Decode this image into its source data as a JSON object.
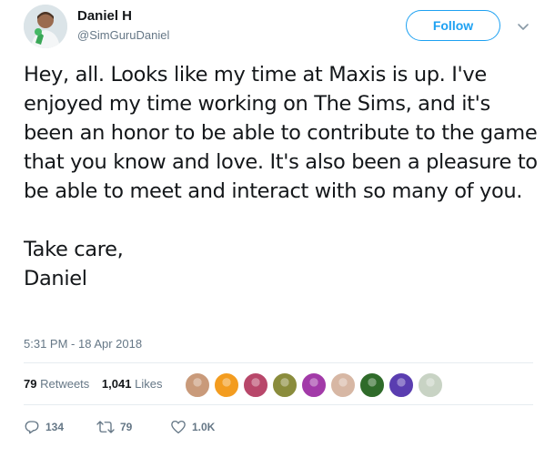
{
  "author": {
    "display_name": "Daniel H",
    "handle": "@SimGuruDaniel"
  },
  "follow_label": "Follow",
  "tweet": {
    "paragraphs": [
      "Hey, all. Looks like my time at Maxis is up. I've enjoyed my time working on The Sims, and it's been an honor to be able to contribute to the game that you know and love. It's also been a pleasure to be able to meet and interact with so many of you.",
      "Take care,",
      "Daniel"
    ],
    "timestamp": "5:31 PM - 18 Apr 2018"
  },
  "stats": {
    "retweets_count": "79",
    "retweets_label": "Retweets",
    "likes_count": "1,041",
    "likes_label": "Likes"
  },
  "liker_avatars": [
    {
      "name": "liker-avatar-1",
      "color": "#c99a7a"
    },
    {
      "name": "liker-avatar-2",
      "color": "#f39c1f"
    },
    {
      "name": "liker-avatar-3",
      "color": "#b8476a"
    },
    {
      "name": "liker-avatar-4",
      "color": "#8a8c3c"
    },
    {
      "name": "liker-avatar-5",
      "color": "#a23aa8"
    },
    {
      "name": "liker-avatar-6",
      "color": "#d7b7a4"
    },
    {
      "name": "liker-avatar-7",
      "color": "#2f6b2a"
    },
    {
      "name": "liker-avatar-8",
      "color": "#5a3db0"
    },
    {
      "name": "liker-avatar-9",
      "color": "#c8d3c4"
    }
  ],
  "actions": {
    "replies_count": "134",
    "retweets_count": "79",
    "likes_count": "1.0K"
  },
  "icons": {
    "reply": "reply-icon",
    "retweet": "retweet-icon",
    "like": "heart-icon",
    "more": "chevron-down-icon"
  },
  "colors": {
    "accent": "#1da1f2",
    "text": "#14171a",
    "secondary": "#657786",
    "divider": "#e6ecf0"
  }
}
